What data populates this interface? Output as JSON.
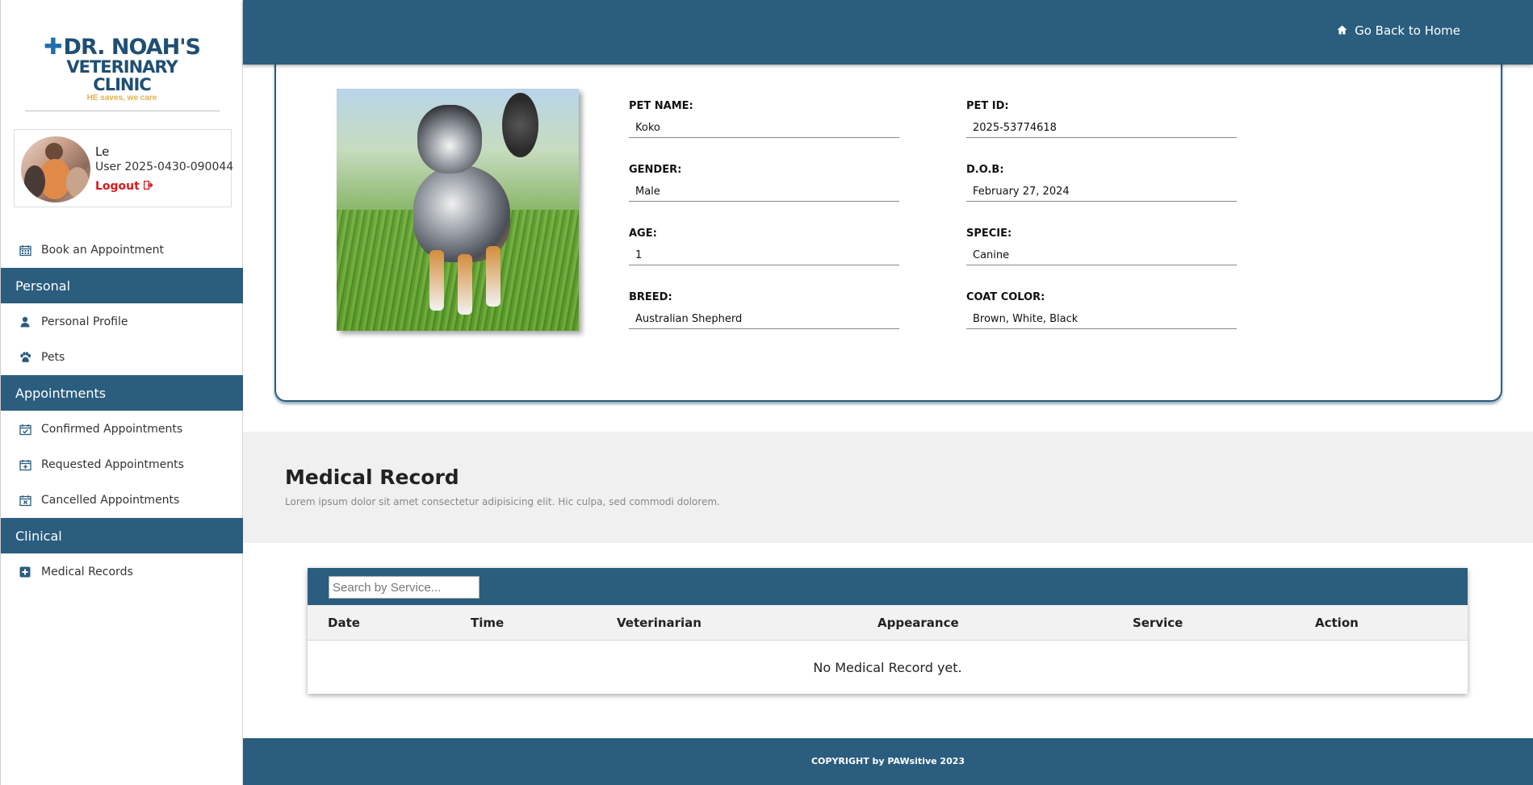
{
  "brand": {
    "name_line1": "DR. NOAH'S",
    "name_line2": "VETERINARY CLINIC",
    "tagline": "HE saves, we care"
  },
  "user": {
    "name": "Le",
    "id_text": "User 2025-0430-090044",
    "logout_label": "Logout"
  },
  "sidebar": {
    "book": "Book an Appointment",
    "sections": [
      {
        "title": "Personal",
        "items": [
          "Personal Profile",
          "Pets"
        ]
      },
      {
        "title": "Appointments",
        "items": [
          "Confirmed Appointments",
          "Requested Appointments",
          "Cancelled Appointments"
        ]
      },
      {
        "title": "Clinical",
        "items": [
          "Medical Records"
        ]
      }
    ]
  },
  "topbar": {
    "home_link": "Go Back to Home"
  },
  "pet": {
    "name_label": "PET NAME:",
    "name": "Koko",
    "id_label": "PET ID:",
    "id": "2025-53774618",
    "gender_label": "GENDER:",
    "gender": "Male",
    "dob_label": "D.O.B:",
    "dob": "February 27, 2024",
    "age_label": "AGE:",
    "age": "1",
    "specie_label": "SPECIE:",
    "specie": "Canine",
    "breed_label": "BREED:",
    "breed": "Australian Shepherd",
    "coat_label": "COAT COLOR:",
    "coat": "Brown, White, Black"
  },
  "medical": {
    "title": "Medical Record",
    "description": "Lorem ipsum dolor sit amet consectetur adipisicing elit. Hic culpa, sed commodi dolorem.",
    "search_placeholder": "Search by Service...",
    "columns": [
      "Date",
      "Time",
      "Veterinarian",
      "Appearance",
      "Service",
      "Action"
    ],
    "empty_message": "No Medical Record yet."
  },
  "footer": {
    "text": "COPYRIGHT by PAWsitive 2023"
  },
  "colors": {
    "primary": "#2b5d7e",
    "logout": "#d61b1b",
    "tagline": "#e3b04b"
  }
}
